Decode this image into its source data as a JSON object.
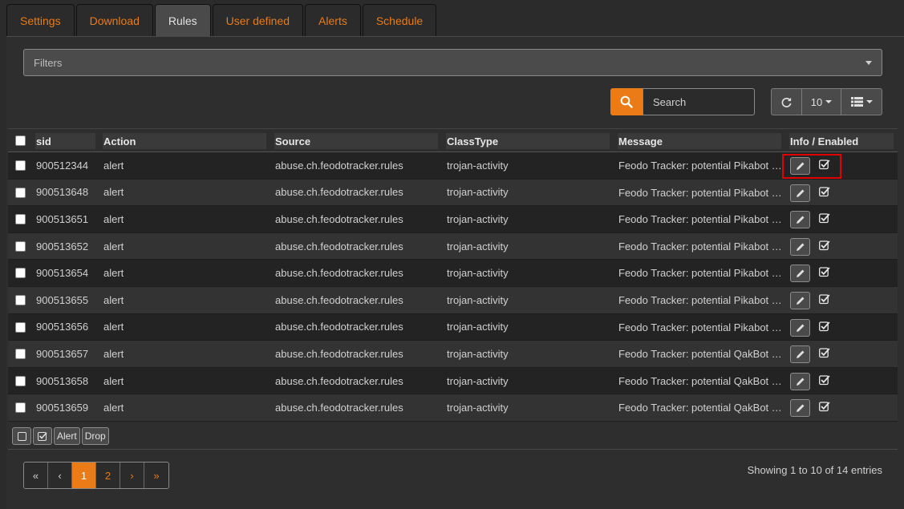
{
  "tabs": [
    {
      "label": "Settings"
    },
    {
      "label": "Download"
    },
    {
      "label": "Rules"
    },
    {
      "label": "User defined"
    },
    {
      "label": "Alerts"
    },
    {
      "label": "Schedule"
    }
  ],
  "active_tab": "Rules",
  "filters": {
    "placeholder": "Filters"
  },
  "search": {
    "placeholder": "Search",
    "value": ""
  },
  "page_size": {
    "value": "10"
  },
  "table": {
    "columns": {
      "sid": "sid",
      "action": "Action",
      "source": "Source",
      "classtype": "ClassType",
      "message": "Message",
      "info_enabled": "Info / Enabled"
    },
    "rows": [
      {
        "sid": "900512344",
        "action": "alert",
        "source": "abuse.ch.feodotracker.rules",
        "classtype": "trojan-activity",
        "message": "Feodo Tracker: potential Pikabot C&C",
        "enabled": true
      },
      {
        "sid": "900513648",
        "action": "alert",
        "source": "abuse.ch.feodotracker.rules",
        "classtype": "trojan-activity",
        "message": "Feodo Tracker: potential Pikabot C&C",
        "enabled": true
      },
      {
        "sid": "900513651",
        "action": "alert",
        "source": "abuse.ch.feodotracker.rules",
        "classtype": "trojan-activity",
        "message": "Feodo Tracker: potential Pikabot C&C",
        "enabled": true
      },
      {
        "sid": "900513652",
        "action": "alert",
        "source": "abuse.ch.feodotracker.rules",
        "classtype": "trojan-activity",
        "message": "Feodo Tracker: potential Pikabot C&C",
        "enabled": true
      },
      {
        "sid": "900513654",
        "action": "alert",
        "source": "abuse.ch.feodotracker.rules",
        "classtype": "trojan-activity",
        "message": "Feodo Tracker: potential Pikabot C&C",
        "enabled": true
      },
      {
        "sid": "900513655",
        "action": "alert",
        "source": "abuse.ch.feodotracker.rules",
        "classtype": "trojan-activity",
        "message": "Feodo Tracker: potential Pikabot C&C",
        "enabled": true
      },
      {
        "sid": "900513656",
        "action": "alert",
        "source": "abuse.ch.feodotracker.rules",
        "classtype": "trojan-activity",
        "message": "Feodo Tracker: potential Pikabot C&C",
        "enabled": true
      },
      {
        "sid": "900513657",
        "action": "alert",
        "source": "abuse.ch.feodotracker.rules",
        "classtype": "trojan-activity",
        "message": "Feodo Tracker: potential QakBot C&C",
        "enabled": true
      },
      {
        "sid": "900513658",
        "action": "alert",
        "source": "abuse.ch.feodotracker.rules",
        "classtype": "trojan-activity",
        "message": "Feodo Tracker: potential QakBot C&C",
        "enabled": true
      },
      {
        "sid": "900513659",
        "action": "alert",
        "source": "abuse.ch.feodotracker.rules",
        "classtype": "trojan-activity",
        "message": "Feodo Tracker: potential QakBot C&C",
        "enabled": true
      }
    ]
  },
  "bulk_actions": {
    "alert_label": "Alert",
    "drop_label": "Drop"
  },
  "pagination": {
    "first": "«",
    "prev": "‹",
    "pages": [
      "1",
      "2"
    ],
    "current": "1",
    "next": "›",
    "last": "»"
  },
  "status": "Showing 1 to 10 of 14 entries",
  "colors": {
    "accent": "#ea7b16",
    "background": "#2b2b2b",
    "highlight": "#e00000"
  }
}
